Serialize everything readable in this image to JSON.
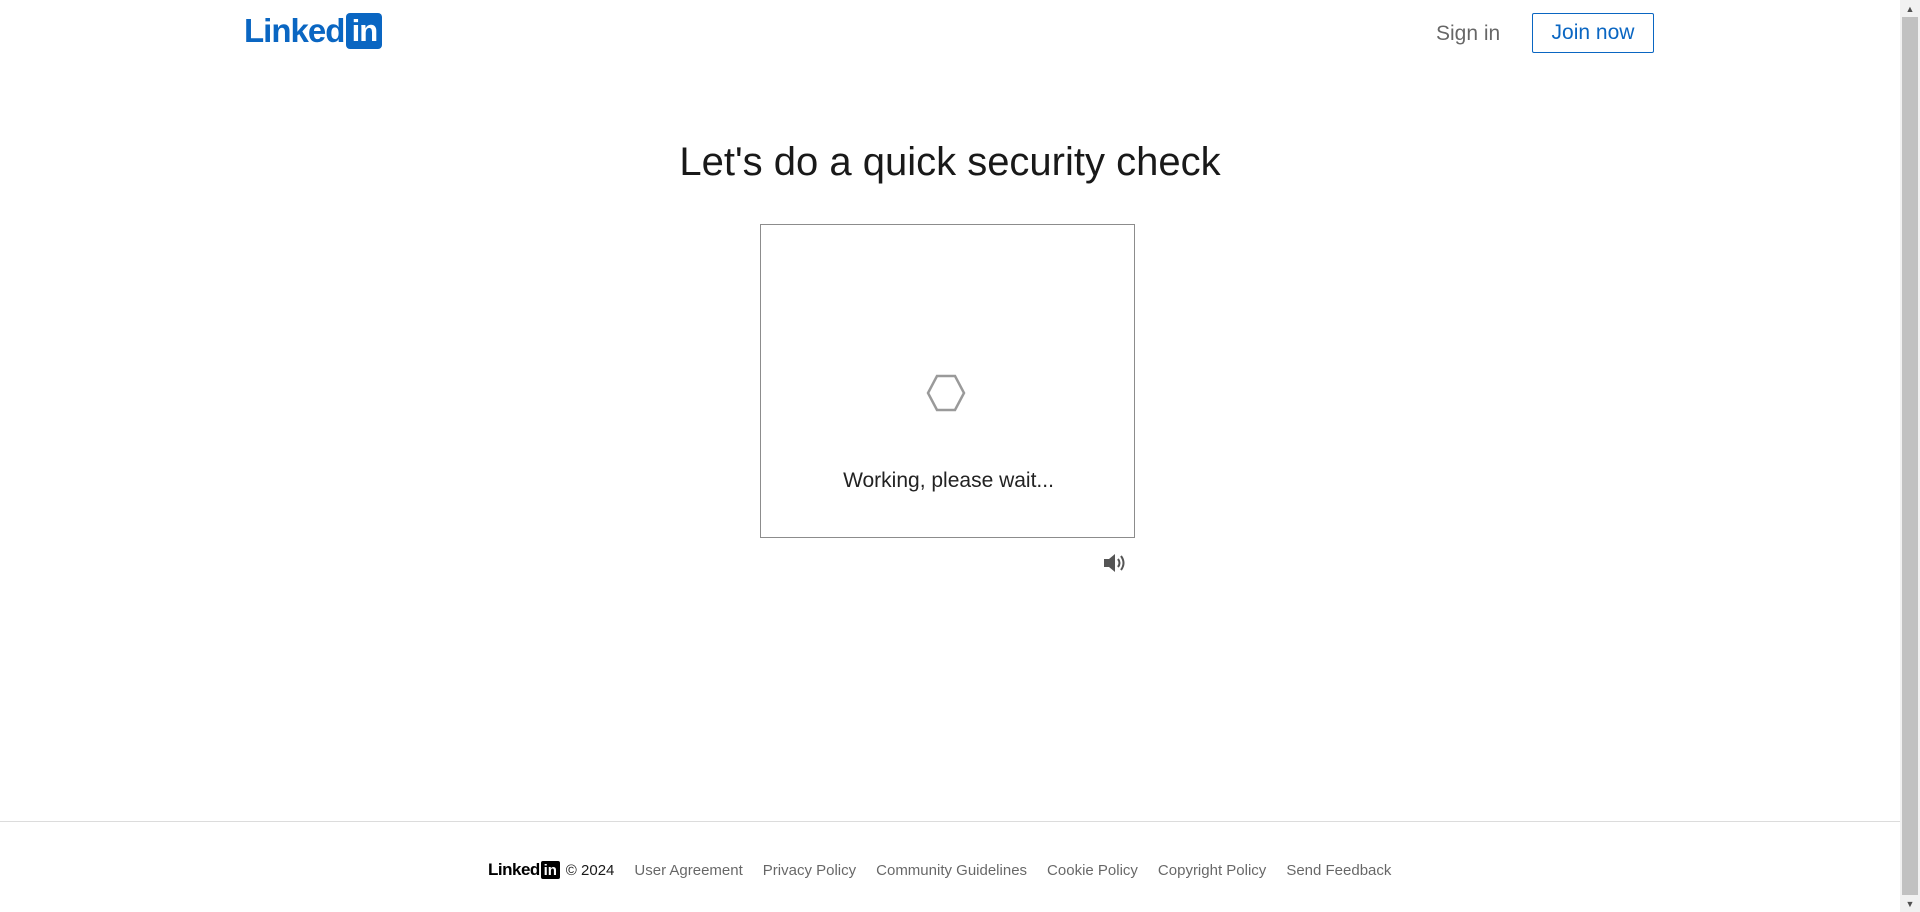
{
  "header": {
    "logo_text": "Linked",
    "logo_box": "in",
    "sign_in": "Sign in",
    "join_now": "Join now"
  },
  "main": {
    "title": "Let's do a quick security check",
    "status": "Working, please wait...",
    "spinner_icon": "hexagon-spinner-icon",
    "audio_icon": "speaker-icon"
  },
  "footer": {
    "logo_text": "Linked",
    "logo_box": "in",
    "copyright": "© 2024",
    "links": [
      "User Agreement",
      "Privacy Policy",
      "Community Guidelines",
      "Cookie Policy",
      "Copyright Policy",
      "Send Feedback"
    ]
  },
  "colors": {
    "brand": "#0a66c2",
    "border": "#8c8c8c"
  }
}
